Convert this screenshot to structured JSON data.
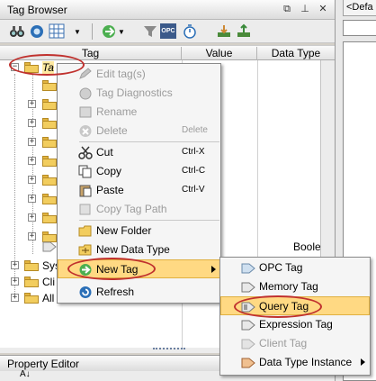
{
  "window": {
    "title": "Tag Browser",
    "controls": [
      "restore-icon",
      "pin-icon",
      "close-icon"
    ]
  },
  "right_panel": {
    "tab_label": "<Defa"
  },
  "toolbar": {
    "icons": [
      "binoculars-icon",
      "tag-search-icon",
      "grid-icon",
      "dropdown-icon",
      "add-icon",
      "dropdown-icon",
      "tag-filter-icon",
      "opc-icon",
      "timer-icon",
      "import-icon",
      "export-icon"
    ],
    "opc_label": "OPC"
  },
  "table": {
    "columns": [
      "Tag",
      "Value",
      "Data Type"
    ],
    "root_label": "Ta",
    "boolean_value": "Boolean",
    "bottom_items": [
      "Sys",
      "Cli",
      "All"
    ]
  },
  "context_menu": {
    "items": [
      {
        "label": "Edit tag(s)",
        "shortcut": "",
        "disabled": true,
        "icon": "edit-tag-icon"
      },
      {
        "label": "Tag Diagnostics",
        "shortcut": "",
        "disabled": true,
        "icon": "diagnostics-icon"
      },
      {
        "label": "Rename",
        "shortcut": "",
        "disabled": true,
        "icon": "rename-icon"
      },
      {
        "label": "Delete",
        "shortcut": "Delete",
        "disabled": true,
        "icon": "delete-icon"
      },
      {
        "label": "Cut",
        "shortcut": "Ctrl-X",
        "disabled": false,
        "icon": "scissors-icon"
      },
      {
        "label": "Copy",
        "shortcut": "Ctrl-C",
        "disabled": false,
        "icon": "copy-icon"
      },
      {
        "label": "Paste",
        "shortcut": "Ctrl-V",
        "disabled": false,
        "icon": "paste-icon"
      },
      {
        "label": "Copy Tag Path",
        "shortcut": "",
        "disabled": true,
        "icon": "copy-path-icon"
      },
      {
        "label": "New Folder",
        "shortcut": "",
        "disabled": false,
        "icon": "new-folder-icon"
      },
      {
        "label": "New Data Type",
        "shortcut": "",
        "disabled": false,
        "icon": "new-data-type-icon"
      },
      {
        "label": "New Tag",
        "shortcut": "",
        "disabled": false,
        "icon": "new-tag-icon",
        "has_submenu": true
      },
      {
        "label": "Refresh",
        "shortcut": "",
        "disabled": false,
        "icon": "refresh-icon"
      }
    ]
  },
  "submenu": {
    "items": [
      {
        "label": "OPC Tag",
        "disabled": false,
        "icon": "opc-tag-icon"
      },
      {
        "label": "Memory Tag",
        "disabled": false,
        "icon": "memory-tag-icon"
      },
      {
        "label": "Query Tag",
        "disabled": false,
        "icon": "query-tag-icon"
      },
      {
        "label": "Expression Tag",
        "disabled": false,
        "icon": "expression-tag-icon"
      },
      {
        "label": "Client Tag",
        "disabled": true,
        "icon": "client-tag-icon"
      },
      {
        "label": "Data Type Instance",
        "disabled": false,
        "icon": "data-type-instance-icon",
        "has_submenu": true
      }
    ]
  },
  "property_editor": {
    "title": "Property Editor",
    "sort_label": "A↓"
  },
  "colors": {
    "highlight": "#ffd983",
    "annotation": "#c0312e",
    "folder": "#f2cd5e"
  }
}
